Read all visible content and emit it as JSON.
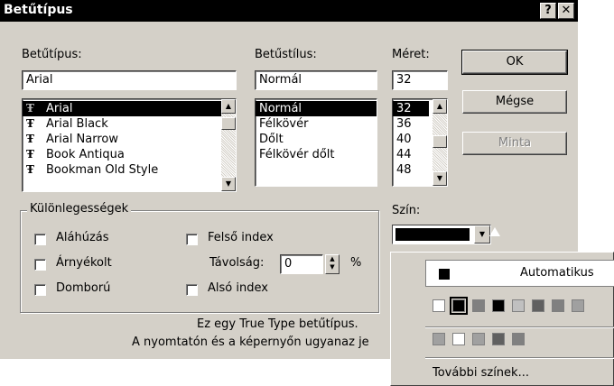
{
  "window": {
    "title": "Betűtípus",
    "help_btn": "?",
    "close_btn": "✕"
  },
  "font": {
    "label": "Betűtípus:",
    "value": "Arial",
    "items": [
      "Arial",
      "Arial Black",
      "Arial Narrow",
      "Book Antiqua",
      "Bookman Old Style"
    ],
    "icon_glyph": "Ŧ"
  },
  "style": {
    "label": "Betűstílus:",
    "value": "Normál",
    "items": [
      "Normál",
      "Félkövér",
      "Dőlt",
      "Félkövér dőlt"
    ]
  },
  "size": {
    "label": "Méret:",
    "value": "32",
    "items": [
      "32",
      "36",
      "40",
      "44",
      "48"
    ]
  },
  "buttons": {
    "ok": "OK",
    "cancel": "Mégse",
    "preview": "Minta"
  },
  "effects": {
    "label": "Különlegességek",
    "underline": "Aláhúzás",
    "shadow": "Árnyékolt",
    "emboss": "Domború",
    "superscript": "Felső index",
    "subscript": "Alsó index",
    "distance_label": "Távolság:",
    "distance_value": "0",
    "distance_unit": "%"
  },
  "color": {
    "label": "Szín:"
  },
  "info": {
    "line1": "Ez egy True Type betűtípus.",
    "line2": "A nyomtatón és a képernyőn ugyanaz je"
  },
  "color_popup": {
    "automatic": "Automatikus",
    "more": "További színek...",
    "row1": [
      "#ffffff",
      "#000000",
      "#808080",
      "#000000",
      "#c0c0c0",
      "#606060",
      "#808080",
      "#a0a0a0"
    ],
    "row2": [
      "#a0a0a0",
      "#ffffff",
      "#a0a0a0",
      "#606060",
      "#808080"
    ]
  },
  "arrows": {
    "up": "▲",
    "down": "▼"
  }
}
